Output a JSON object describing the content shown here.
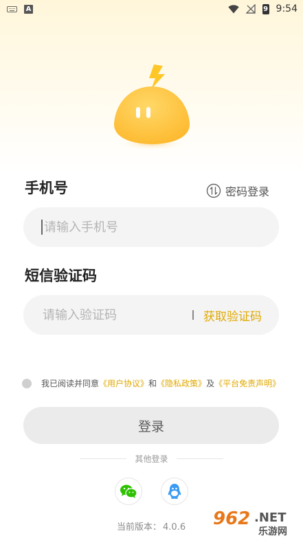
{
  "status_bar": {
    "left_icon_letter": "A",
    "battery_digit": "9",
    "time": "9:54"
  },
  "form": {
    "phone_label": "手机号",
    "password_login_label": "密码登录",
    "phone_placeholder": "请输入手机号",
    "sms_label": "短信验证码",
    "code_placeholder": "请输入验证码",
    "get_code_label": "获取验证码"
  },
  "agreement": {
    "prefix": "我已阅读并同意",
    "user_agreement": "《用户协议》",
    "and": "和",
    "privacy_policy": "《隐私政策》",
    "also": "及",
    "disclaimer": "《平台免责声明》"
  },
  "login_button_label": "登录",
  "other_login_label": "其他登录",
  "version": {
    "label": "当前版本：",
    "value": "4.0.6"
  },
  "watermark": {
    "brand": "962",
    "suffix": ".NET",
    "sub": "乐游网"
  },
  "colors": {
    "accent": "#E0A800",
    "mascot": "#FFC83D",
    "field_bg": "#F4F4F4"
  },
  "icons": {
    "password_login": "swap-icon",
    "wechat": "wechat-icon",
    "qq": "qq-icon"
  }
}
